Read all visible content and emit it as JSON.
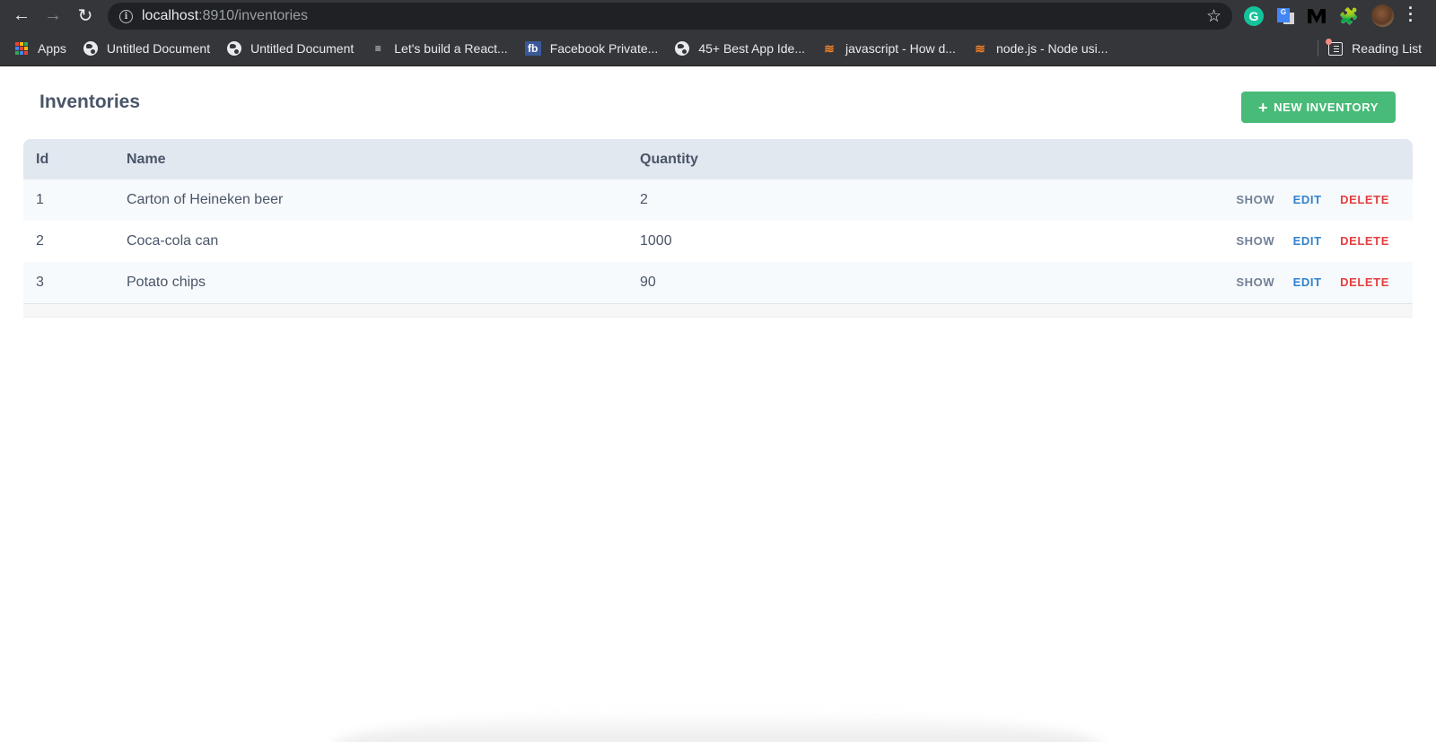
{
  "browser": {
    "url_host": "localhost",
    "url_rest": ":8910/inventories",
    "bookmarks": [
      {
        "label": "Apps",
        "icon": "apps-grid-icon"
      },
      {
        "label": "Untitled Document",
        "icon": "globe-icon"
      },
      {
        "label": "Untitled Document",
        "icon": "globe-icon"
      },
      {
        "label": "Let's build a React...",
        "icon": "list-icon"
      },
      {
        "label": "Facebook Private...",
        "icon": "facebook-icon"
      },
      {
        "label": "45+ Best App Ide...",
        "icon": "globe-icon"
      },
      {
        "label": "javascript - How d...",
        "icon": "stackoverflow-icon"
      },
      {
        "label": "node.js - Node usi...",
        "icon": "stackoverflow-icon"
      }
    ],
    "reading_list_label": "Reading List",
    "grammarly_glyph": "G",
    "translate_glyph": "G"
  },
  "page": {
    "title": "Inventories",
    "new_button_label": "NEW INVENTORY",
    "new_button_icon": "+",
    "accent_color": "#48bb78"
  },
  "table": {
    "columns": [
      "Id",
      "Name",
      "Quantity"
    ],
    "rows": [
      {
        "id": "1",
        "name": "Carton of Heineken beer",
        "quantity": "2"
      },
      {
        "id": "2",
        "name": "Coca-cola can",
        "quantity": "1000"
      },
      {
        "id": "3",
        "name": "Potato chips",
        "quantity": "90"
      }
    ],
    "actions": {
      "show": "SHOW",
      "edit": "EDIT",
      "delete": "DELETE"
    },
    "action_colors": {
      "show": "#718096",
      "edit": "#3182ce",
      "delete": "#e53e3e"
    }
  }
}
